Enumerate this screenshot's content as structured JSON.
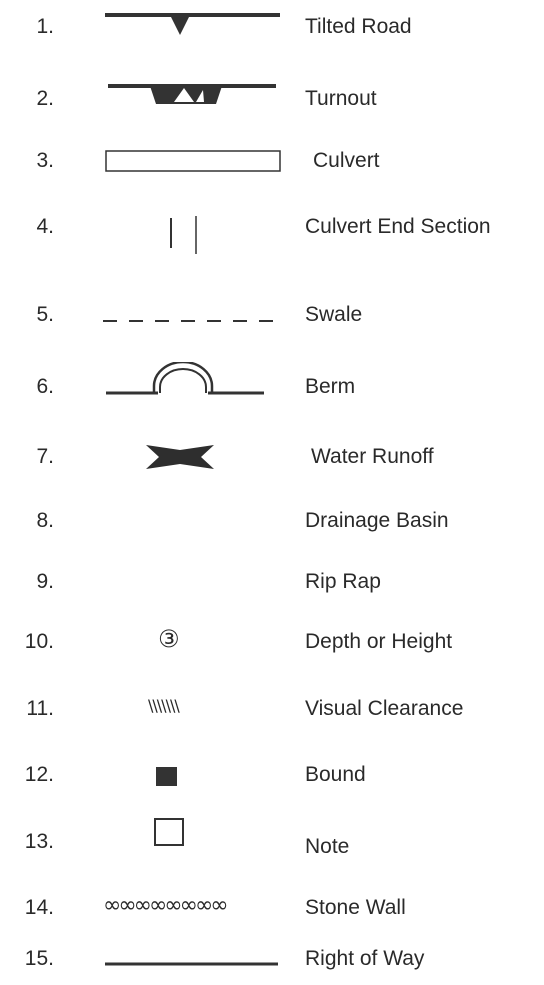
{
  "legend": {
    "items": [
      {
        "number": "1.",
        "label": "Tilted Road",
        "symbol": "tilted-road-icon"
      },
      {
        "number": "2.",
        "label": "Turnout",
        "symbol": "turnout-icon"
      },
      {
        "number": "3.",
        "label": "Culvert",
        "symbol": "culvert-icon"
      },
      {
        "number": "4.",
        "label": "Culvert End Section",
        "symbol": "culvert-end-section-icon"
      },
      {
        "number": "5.",
        "label": "Swale",
        "symbol": "swale-icon"
      },
      {
        "number": "6.",
        "label": "Berm",
        "symbol": "berm-icon"
      },
      {
        "number": "7.",
        "label": "Water Runoff",
        "symbol": "water-runoff-icon"
      },
      {
        "number": "8.",
        "label": "Drainage Basin",
        "symbol": "drainage-basin-icon"
      },
      {
        "number": "9.",
        "label": "Rip Rap",
        "symbol": "rip-rap-icon"
      },
      {
        "number": "10.",
        "label": "Depth or Height",
        "symbol": "depth-marker-icon",
        "glyph": "③"
      },
      {
        "number": "11.",
        "label": "Visual Clearance",
        "symbol": "visual-clearance-icon",
        "glyph": "\\\\\\\\\\\\\\"
      },
      {
        "number": "12.",
        "label": "Bound",
        "symbol": "bound-icon"
      },
      {
        "number": "13.",
        "label": "Note",
        "symbol": "note-icon"
      },
      {
        "number": "14.",
        "label": "Stone Wall",
        "symbol": "stone-wall-icon",
        "glyph": "∞∞∞∞∞∞∞∞"
      },
      {
        "number": "15.",
        "label": "Right of Way",
        "symbol": "right-of-way-icon"
      }
    ]
  }
}
